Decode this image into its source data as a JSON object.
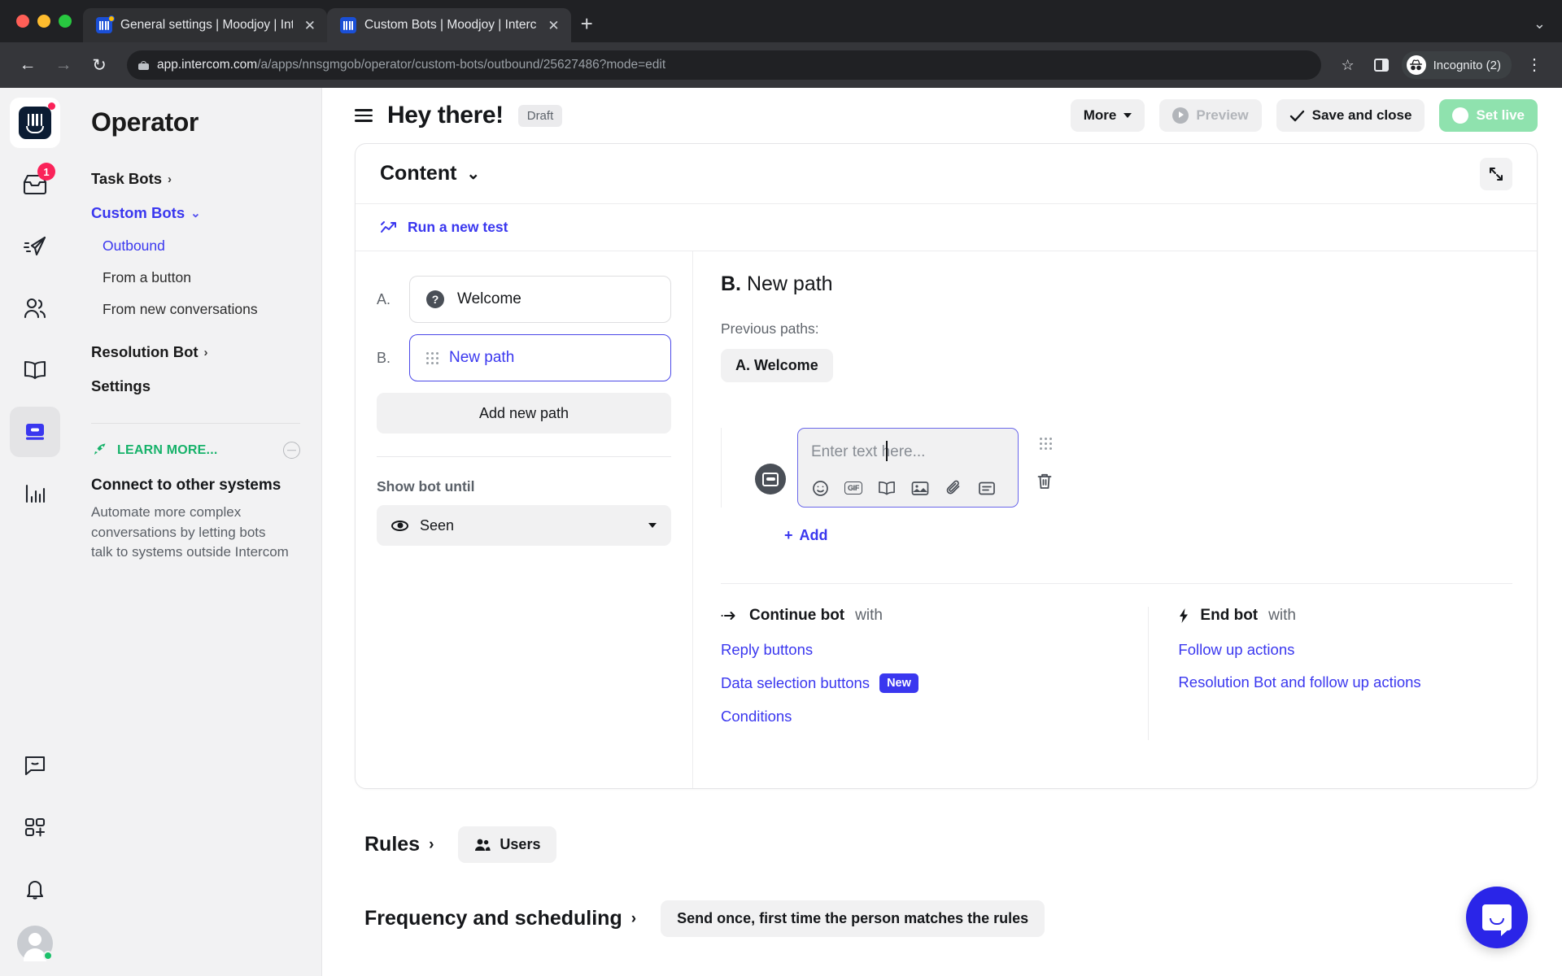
{
  "browser": {
    "tabs": [
      {
        "title": "General settings | Moodjoy | Int",
        "active": false,
        "close": "✕"
      },
      {
        "title": "Custom Bots | Moodjoy | Interc",
        "active": true,
        "close": "✕"
      }
    ],
    "new_tab_label": "+",
    "window_chevron": "⌄",
    "nav": {
      "back": "←",
      "forward": "→",
      "reload": "↻"
    },
    "url_domain": "app.intercom.com",
    "url_path": "/a/apps/nnsgmgob/operator/custom-bots/outbound/25627486?mode=edit",
    "star": "☆",
    "profile_label": "Incognito (2)",
    "menu": "⋮"
  },
  "rail": {
    "items": [
      {
        "name": "intercom-logo",
        "badge": ""
      },
      {
        "name": "inbox",
        "badge": "1"
      },
      {
        "name": "send",
        "badge": ""
      },
      {
        "name": "contacts",
        "badge": ""
      },
      {
        "name": "articles",
        "badge": ""
      },
      {
        "name": "operator",
        "badge": ""
      },
      {
        "name": "reports",
        "badge": ""
      },
      {
        "name": "messenger",
        "badge": ""
      },
      {
        "name": "apps",
        "badge": ""
      },
      {
        "name": "notifications",
        "badge": ""
      }
    ]
  },
  "sidebar": {
    "title": "Operator",
    "items": [
      {
        "label": "Task Bots",
        "chevron": "›",
        "accent": false,
        "sub": false
      },
      {
        "label": "Custom Bots",
        "chevron": "⌄",
        "accent": true,
        "sub": false
      },
      {
        "label": "Outbound",
        "chevron": "",
        "accent": true,
        "sub": true
      },
      {
        "label": "From a button",
        "chevron": "",
        "accent": false,
        "sub": true
      },
      {
        "label": "From new conversations",
        "chevron": "",
        "accent": false,
        "sub": true
      },
      {
        "label": "Resolution Bot",
        "chevron": "›",
        "accent": false,
        "sub": false
      },
      {
        "label": "Settings",
        "chevron": "",
        "accent": false,
        "sub": false
      }
    ],
    "learn_more": {
      "label": "LEARN MORE...",
      "icon": "rocket-icon",
      "collapse": "minus-circle-icon",
      "card_title": "Connect to other systems",
      "card_body": "Automate more complex conversations by letting bots talk to systems outside Intercom"
    }
  },
  "header": {
    "title": "Hey there!",
    "status": "Draft",
    "more_label": "More",
    "preview_label": "Preview",
    "save_label": "Save and close",
    "setlive_label": "Set live"
  },
  "content_card": {
    "title": "Content",
    "title_chevron": "⌄",
    "expand_icon": "expand-diagonal-icon",
    "run_test_label": "Run a new test",
    "paths": [
      {
        "letter": "A.",
        "label": "Welcome",
        "icon": "question-circle-icon",
        "selected": false
      },
      {
        "letter": "B.",
        "label": "New path",
        "icon": "drag-grip-icon",
        "selected": true
      }
    ],
    "add_path_label": "Add new path",
    "show_until_label": "Show bot until",
    "show_until_value": "Seen",
    "show_until_icon": "eye-icon"
  },
  "path_detail": {
    "prefix": "B.",
    "title": "New path",
    "previous_label": "Previous paths:",
    "previous_paths": [
      "A. Welcome"
    ],
    "editor": {
      "placeholder": "Enter text here...",
      "tools": [
        "emoji-icon",
        "gif-icon",
        "article-icon",
        "image-icon",
        "attachment-icon",
        "card-icon"
      ],
      "drag_handle": "drag-grip-icon",
      "delete": "trash-icon",
      "add_label": "Add",
      "add_plus": "+"
    },
    "continue": {
      "heading_bold": "Continue bot",
      "heading_rest": "with",
      "icon": "arrow-continue-icon",
      "links": [
        {
          "label": "Reply buttons",
          "tag": ""
        },
        {
          "label": "Data selection buttons",
          "tag": "New"
        },
        {
          "label": "Conditions",
          "tag": ""
        }
      ]
    },
    "end": {
      "heading_bold": "End bot",
      "heading_rest": "with",
      "icon": "bolt-icon",
      "links": [
        {
          "label": "Follow up actions",
          "tag": ""
        },
        {
          "label": "Resolution Bot and follow up actions",
          "tag": ""
        }
      ]
    }
  },
  "sections": [
    {
      "title": "Rules",
      "chevron": "›",
      "chip": "Users",
      "chip_icon": "people-icon"
    },
    {
      "title": "Frequency and scheduling",
      "chevron": "›",
      "chip": "Send once, first time the person matches the rules",
      "chip_icon": ""
    }
  ],
  "messenger_launcher": {
    "icon": "messenger-bubble-icon"
  },
  "colors": {
    "accent": "#3a37ef",
    "accent_dark": "#2a25e8",
    "green": "#8fe2ae",
    "learn_green": "#17b26a",
    "badge_red": "#fa2359"
  }
}
